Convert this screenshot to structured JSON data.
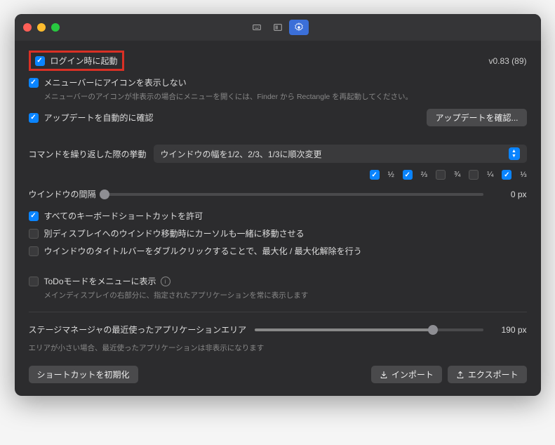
{
  "version": "v0.83 (89)",
  "checkboxes": {
    "launch_at_login": {
      "label": "ログイン時に起動",
      "checked": true
    },
    "hide_menubar_icon": {
      "label": "メニューバーにアイコンを表示しない",
      "checked": true
    },
    "hide_menubar_hint": "メニューバーのアイコンが非表示の場合にメニューを開くには、Finder から Rectangle を再起動してください。",
    "auto_check_updates": {
      "label": "アップデートを自動的に確認",
      "checked": true
    },
    "allow_all_shortcuts": {
      "label": "すべてのキーボードショートカットを許可",
      "checked": true
    },
    "move_cursor_with_window": {
      "label": "別ディスプレイへのウインドウ移動時にカーソルも一緒に移動させる",
      "checked": false
    },
    "titlebar_doubleclick": {
      "label": "ウインドウのタイトルバーをダブルクリックすることで、最大化 / 最大化解除を行う",
      "checked": false
    },
    "todo_mode": {
      "label": "ToDoモードをメニューに表示",
      "checked": false
    },
    "todo_hint": "メインディスプレイの右部分に、指定されたアプリケーションを常に表示します"
  },
  "buttons": {
    "check_updates": "アップデートを確認...",
    "reset_shortcuts": "ショートカットを初期化",
    "import": "インポート",
    "export": "エクスポート"
  },
  "repeat": {
    "label": "コマンドを繰り返した際の挙動",
    "selected": "ウインドウの幅を1/2、2/3、1/3に順次変更"
  },
  "fractions": [
    {
      "label": "½",
      "checked": true
    },
    {
      "label": "⅔",
      "checked": true
    },
    {
      "label": "¾",
      "checked": false
    },
    {
      "label": "¼",
      "checked": false
    },
    {
      "label": "⅓",
      "checked": true
    }
  ],
  "gap_slider": {
    "label": "ウインドウの間隔",
    "value": "0 px",
    "percent": 0
  },
  "stage_slider": {
    "label": "ステージマネージャの最近使ったアプリケーションエリア",
    "value": "190 px",
    "percent": 78,
    "hint": "エリアが小さい場合、最近使ったアプリケーションは非表示になります"
  }
}
